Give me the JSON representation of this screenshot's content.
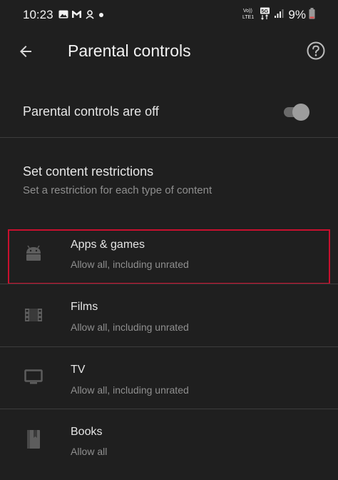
{
  "status_bar": {
    "time": "10:23",
    "battery": "9%",
    "icons_left": [
      "image-icon",
      "gmail-icon",
      "notification-icon",
      "dot-icon"
    ],
    "icons_right": [
      "volte-icon",
      "5g-icon",
      "signal-icon",
      "battery-icon"
    ],
    "network_label": "5G",
    "volte_label": "Vo)) LTE1"
  },
  "app_bar": {
    "title": "Parental controls",
    "back_icon": "arrow-back-icon",
    "help_icon": "help-circle-icon"
  },
  "parental_toggle": {
    "label": "Parental controls are off",
    "state": "off"
  },
  "restrictions": {
    "title": "Set content restrictions",
    "subtitle": "Set a restriction for each type of content",
    "items": [
      {
        "title": "Apps & games",
        "subtitle": "Allow all, including unrated",
        "icon": "android-icon",
        "highlighted": true
      },
      {
        "title": "Films",
        "subtitle": "Allow all, including unrated",
        "icon": "film-icon",
        "highlighted": false
      },
      {
        "title": "TV",
        "subtitle": "Allow all, including unrated",
        "icon": "tv-icon",
        "highlighted": false
      },
      {
        "title": "Books",
        "subtitle": "Allow all",
        "icon": "book-icon",
        "highlighted": false
      }
    ]
  },
  "colors": {
    "background": "#1f1f1f",
    "highlight": "#c8102e",
    "secondary_text": "#8f8f8f"
  }
}
